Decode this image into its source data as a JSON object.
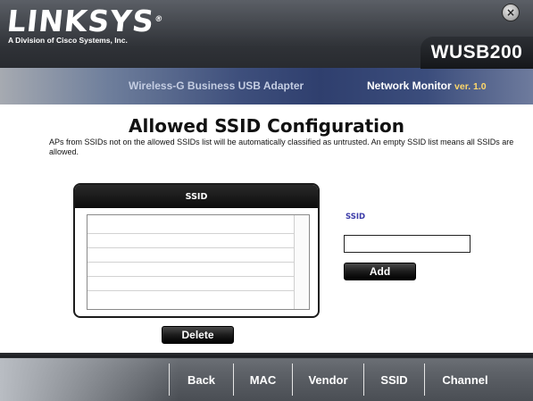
{
  "header": {
    "brand": "LINKSYS",
    "brand_mark": "®",
    "brand_subtitle": "A Division of Cisco Systems, Inc.",
    "model": "WUSB200",
    "product_name": "Wireless-G Business USB Adapter",
    "app_name": "Network Monitor",
    "version": "ver. 1.0",
    "close_icon_glyph": "×"
  },
  "page": {
    "title": "Allowed SSID Configuration",
    "description": "APs from SSIDs not on the allowed SSIDs list will be automatically classified as untrusted. An empty SSID list means all SSIDs are allowed."
  },
  "ssid_list": {
    "column_header": "SSID",
    "rows": []
  },
  "form": {
    "ssid_label": "SSID",
    "ssid_value": "",
    "add_label": "Add",
    "delete_label": "Delete"
  },
  "nav": {
    "items": [
      {
        "label": "Back"
      },
      {
        "label": "MAC"
      },
      {
        "label": "Vendor"
      },
      {
        "label": "SSID"
      },
      {
        "label": "Channel"
      }
    ]
  },
  "colors": {
    "label_blue": "#3a3aa8",
    "version_yellow": "#ffd86a",
    "header_dark": "#1d1f23",
    "band_blue": "#2f3f6e"
  }
}
